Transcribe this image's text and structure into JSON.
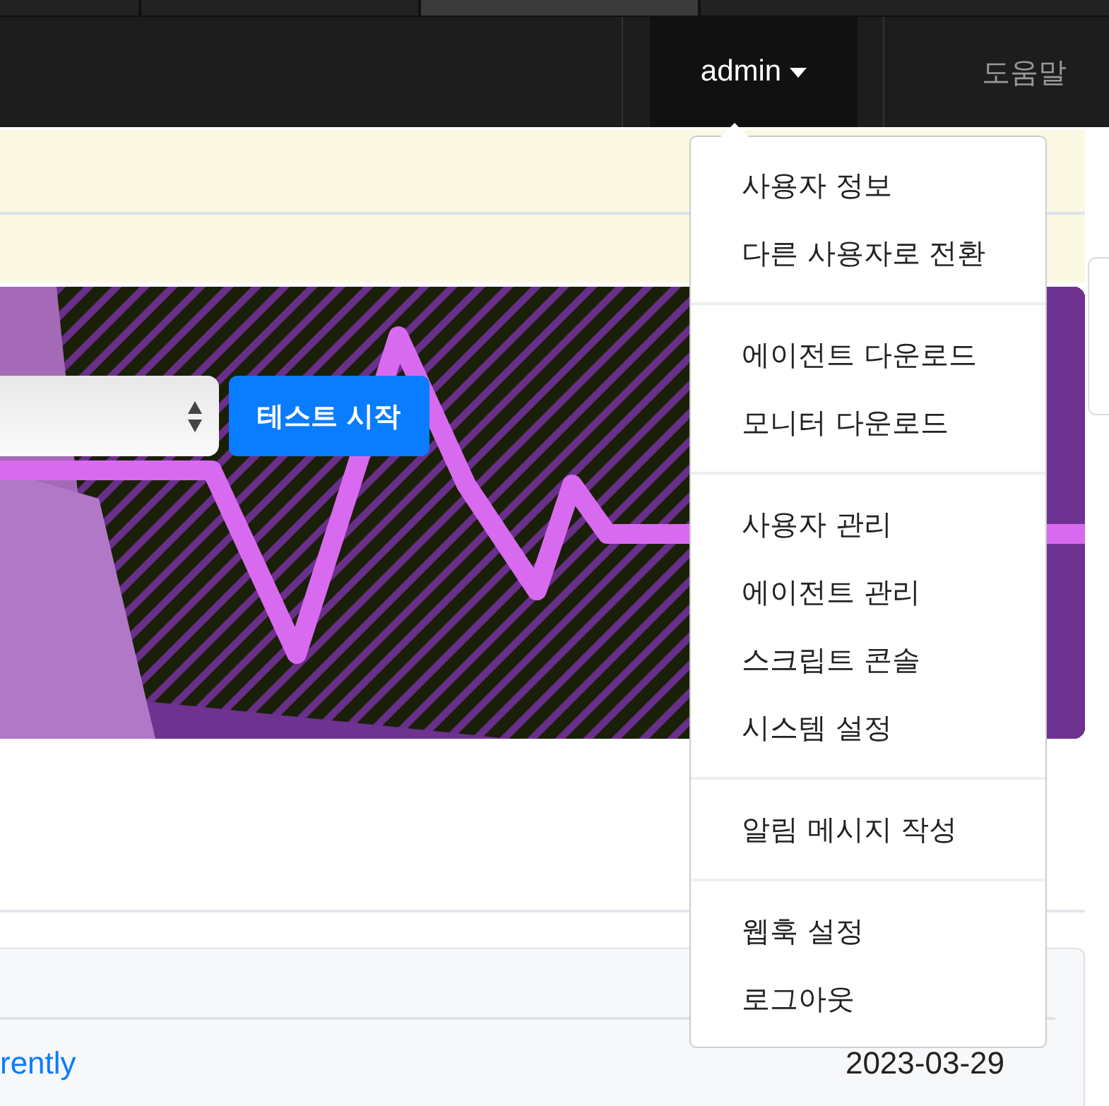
{
  "navbar": {
    "user_menu": {
      "label": "admin",
      "expanded": true
    },
    "help": "도움말"
  },
  "user_dropdown": {
    "groups": [
      {
        "items": [
          "사용자 정보",
          "다른 사용자로 전환"
        ]
      },
      {
        "items": [
          "에이전트 다운로드",
          "모니터 다운로드"
        ]
      },
      {
        "items": [
          "사용자 관리",
          "에이전트 관리",
          "스크립트 콘솔",
          "시스템 설정"
        ]
      },
      {
        "items": [
          "알림 메시지 작성"
        ]
      },
      {
        "items": [
          "웹훅 설정",
          "로그아웃"
        ]
      }
    ]
  },
  "banner": {
    "start_button": "테스트 시작"
  },
  "recent": {
    "rows": [
      {
        "title": "rently",
        "date": "2023-03-29"
      }
    ]
  }
}
